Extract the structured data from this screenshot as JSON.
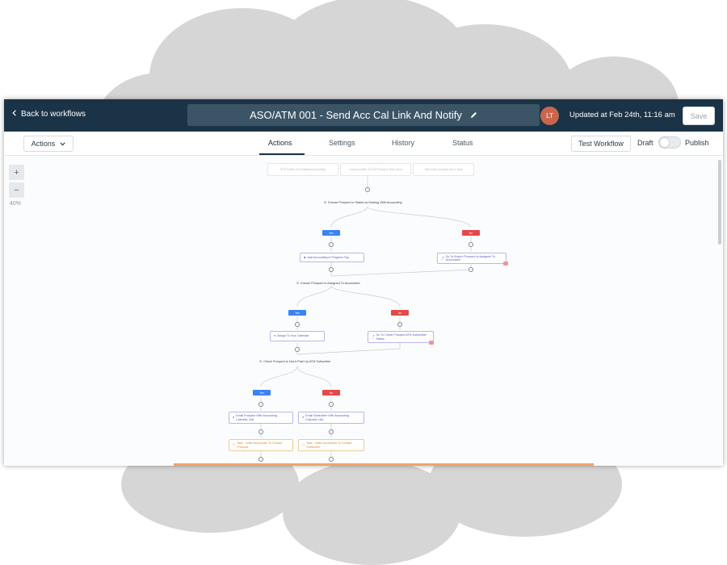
{
  "header": {
    "back_label": "Back to workflows",
    "title": "ASO/ATM 001 - Send Acc Cal Link And Notify",
    "avatar_initials": "LT",
    "updated": "Updated at Feb 24th, 11:16 am",
    "save_label": "Save"
  },
  "subbar": {
    "actions_label": "Actions",
    "tabs": [
      {
        "label": "Actions",
        "active": true
      },
      {
        "label": "Settings",
        "active": false
      },
      {
        "label": "History",
        "active": false
      },
      {
        "label": "Status",
        "active": false
      }
    ],
    "test_label": "Test Workflow",
    "draft_label": "Draft",
    "publish_label": "Publish"
  },
  "canvas": {
    "zoom_in": "+",
    "zoom_out": "−",
    "zoom_level": "40%",
    "triggers": [
      "ATM Tickets Set Assistant Accounting",
      "Contact Added To ATM Ready to Start (Acc)",
      "Task when prospect has 4 days"
    ],
    "nodes": {
      "cond1": "Ensure Prospect Is Stated as Dealing With Accounting",
      "yes_label": "Yes",
      "no_label": "No",
      "add_tag": "Add Accounting In Progress Tag",
      "goto1": "Go To Ensure Prospect Is Assigned To Accountant",
      "cond2": "Ensure Prospect Is Assigned To Accountant",
      "assign": "Assign To Your Calendar",
      "goto2": "Go To Check Prospect ATM Subscriber Status",
      "cond3": "Check Prospect Is Not A Paid Up ATM Subscriber",
      "email1": "Email Prospect With Accounting Calendar Link",
      "email2": "Email Subscriber With Accounting Calendar Link",
      "task1": "Task - Invite Accountant To Contact Prospect",
      "task2": "Task - Invite Accountant To Contact Subscriber",
      "err": "!"
    }
  },
  "colors": {
    "topbar": "#1b3346",
    "yes": "#3b82f6",
    "no": "#e54848",
    "action_border": "#b9b4ef",
    "task_border": "#f4c892"
  }
}
